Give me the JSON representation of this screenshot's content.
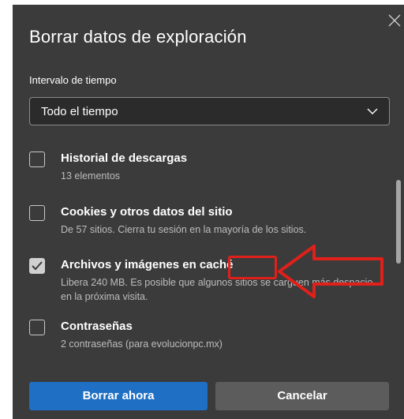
{
  "dialog": {
    "title": "Borrar datos de exploración",
    "close_icon": "close-icon",
    "time_range": {
      "label": "Intervalo de tiempo",
      "selected": "Todo el tiempo",
      "icon": "chevron-down-icon"
    },
    "items": [
      {
        "title": "Historial de descargas",
        "description": "13 elementos",
        "checked": false
      },
      {
        "title": "Cookies y otros datos del sitio",
        "description": "De 57 sitios. Cierra tu sesión en la mayoría de los sitios.",
        "checked": false
      },
      {
        "title": "Archivos y imágenes en caché",
        "description": "Libera 240 MB. Es posible que algunos sitios se carguen más despacio en la próxima visita.",
        "checked": true
      },
      {
        "title": "Contraseñas",
        "description": "2 contraseñas (para evolucionpc.mx)",
        "checked": false
      }
    ],
    "buttons": {
      "primary": "Borrar ahora",
      "secondary": "Cancelar"
    }
  },
  "colors": {
    "dialog_bg": "#3b3b3b",
    "primary_button": "#1f6fc4",
    "secondary_button": "#5c5c5c",
    "annotation_red": "#e0201a"
  }
}
